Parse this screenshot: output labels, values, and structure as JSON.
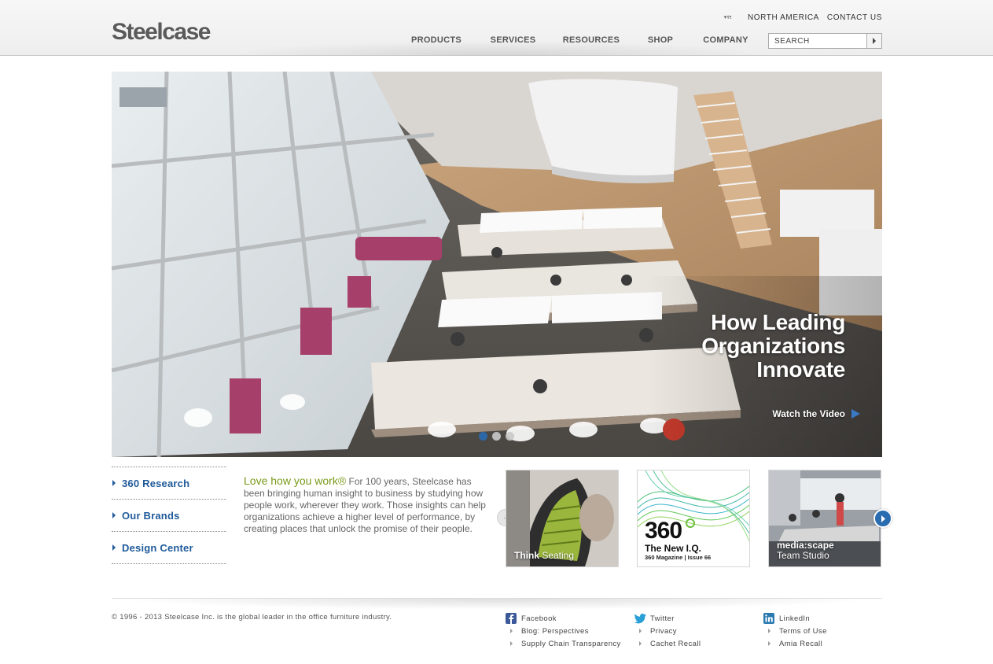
{
  "header": {
    "logo_text": "Steelcase",
    "region_link": "NORTH AMERICA",
    "contact_link": "CONTACT US",
    "nav": [
      "PRODUCTS",
      "SERVICES",
      "RESOURCES",
      "SHOP",
      "COMPANY"
    ],
    "search_placeholder": "SEARCH"
  },
  "hero": {
    "headline": [
      "How Leading",
      "Organizations",
      "Innovate"
    ],
    "cta": "Watch the Video",
    "slides": 3,
    "active_slide": 1
  },
  "side_links": [
    "360 Research",
    "Our Brands",
    "Design Center"
  ],
  "intro": {
    "tagline": "Love how you work®",
    "body": "For 100 years, Steelcase has been bringing human insight to business by studying how people work, wherever they work. Those insights can help organizations achieve a higher level of performance, by creating places that unlock the promise of their people."
  },
  "carousel": {
    "tiles": [
      {
        "label_bold": "Think",
        "label_rest": " Seating"
      },
      {
        "big": "360",
        "line1": "The New I.Q.",
        "line2": "360 Magazine | Issue 66"
      },
      {
        "line1": "media:scape",
        "line2": "Team Studio"
      }
    ]
  },
  "footer": {
    "copyright": "© 1996 - 2013 Steelcase Inc. is the global leader in the office furniture industry.",
    "col1": [
      "Facebook",
      "Blog: Perspectives",
      "Supply Chain Transparency"
    ],
    "col2": [
      "Twitter",
      "Privacy",
      "Cachet Recall"
    ],
    "col3": [
      "LinkedIn",
      "Terms of Use",
      "Amia Recall"
    ]
  },
  "colors": {
    "link_blue": "#1f5a99",
    "tagline_green": "#7a9a1a",
    "active_dot": "#2a6cb0"
  }
}
